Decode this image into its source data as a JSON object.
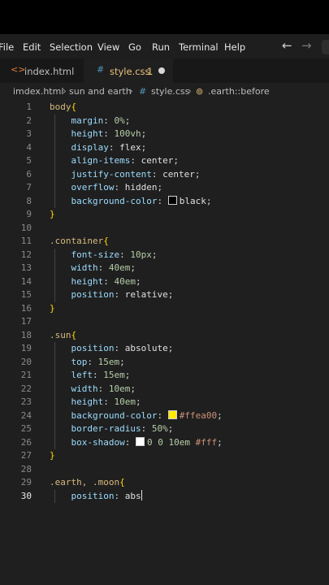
{
  "menubar": {
    "items": [
      "File",
      "Edit",
      "Selection",
      "View",
      "Go",
      "Run",
      "Terminal",
      "Help"
    ],
    "back_icon": "arrow-left-icon",
    "forward_icon": "arrow-right-icon"
  },
  "tabs": [
    {
      "icon": "<>",
      "label": "index.html",
      "active": false,
      "modified": false
    },
    {
      "icon": "#",
      "label": "style.css",
      "badge": "1",
      "active": true,
      "modified": true
    }
  ],
  "breadcrumb": {
    "parts": [
      "imdex.html",
      "sun and earth",
      "style.css",
      ".earth::before"
    ],
    "css_icon": "#",
    "symbol_icon": "symbol-class-icon"
  },
  "editor": {
    "current_line": 30,
    "lines": [
      {
        "n": "1",
        "text": "body{"
      },
      {
        "n": "2",
        "text": "    margin: 0%;"
      },
      {
        "n": "3",
        "text": "    height: 100vh;"
      },
      {
        "n": "4",
        "text": "    display: flex;"
      },
      {
        "n": "5",
        "text": "    align-items: center;"
      },
      {
        "n": "6",
        "text": "    justify-content: center;"
      },
      {
        "n": "7",
        "text": "    overflow: hidden;"
      },
      {
        "n": "8",
        "text": "    background-color: black;",
        "swatch": "#000000"
      },
      {
        "n": "9",
        "text": "}"
      },
      {
        "n": "10",
        "text": ""
      },
      {
        "n": "11",
        "text": ".container{"
      },
      {
        "n": "12",
        "text": "    font-size: 10px;"
      },
      {
        "n": "13",
        "text": "    width: 40em;"
      },
      {
        "n": "14",
        "text": "    height: 40em;"
      },
      {
        "n": "15",
        "text": "    position: relative;"
      },
      {
        "n": "16",
        "text": "}"
      },
      {
        "n": "17",
        "text": ""
      },
      {
        "n": "18",
        "text": ".sun{"
      },
      {
        "n": "19",
        "text": "    position: absolute;"
      },
      {
        "n": "20",
        "text": "    top: 15em;"
      },
      {
        "n": "21",
        "text": "    left: 15em;"
      },
      {
        "n": "22",
        "text": "    width: 10em;"
      },
      {
        "n": "23",
        "text": "    height: 10em;"
      },
      {
        "n": "24",
        "text": "    background-color: #ffea00;",
        "swatch": "#ffea00"
      },
      {
        "n": "25",
        "text": "    border-radius: 50%;"
      },
      {
        "n": "26",
        "text": "    box-shadow: 0 0 10em #fff;",
        "swatch": "#ffffff"
      },
      {
        "n": "27",
        "text": "}"
      },
      {
        "n": "28",
        "text": ""
      },
      {
        "n": "29",
        "text": ".earth, .moon{"
      },
      {
        "n": "30",
        "text": "    position: abs"
      }
    ]
  },
  "colors": {
    "editor_bg": "#1f1f1f",
    "selector": "#d7ba7d",
    "property": "#9cdcfe",
    "value": "#ce9178",
    "number": "#b5cea8",
    "brace": "#ffd700",
    "html_icon": "#e37933",
    "css_icon": "#519aba"
  }
}
